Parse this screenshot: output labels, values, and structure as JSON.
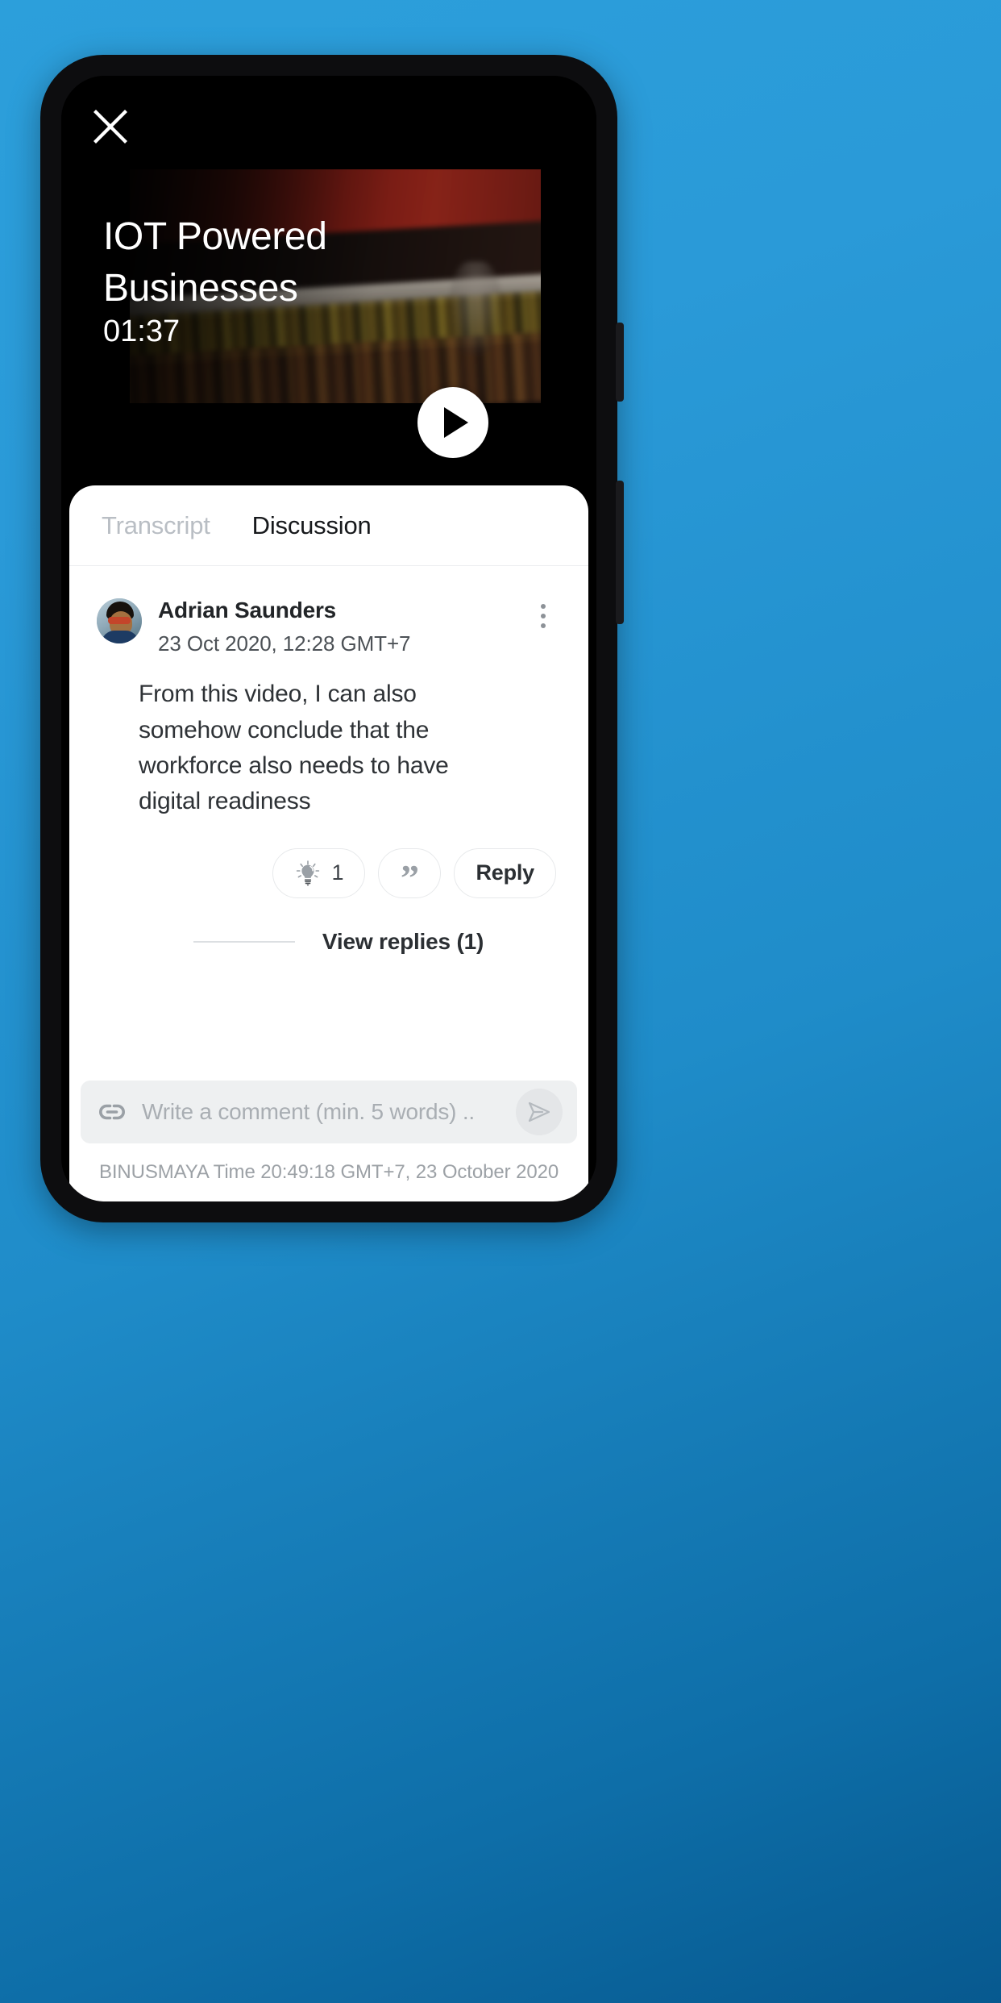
{
  "video": {
    "close_icon": "close-icon",
    "title": "IOT Powered\nBusinesses",
    "duration": "01:37",
    "play_icon": "play-icon"
  },
  "tabs": [
    {
      "label": "Transcript",
      "active": false
    },
    {
      "label": "Discussion",
      "active": true
    }
  ],
  "comment": {
    "author": "Adrian Saunders",
    "timestamp": "23 Oct 2020, 12:28 GMT+7",
    "body": "From this video, I can also somehow conclude that the workforce also needs to have digital readiness",
    "avatar_icon": "user-avatar",
    "menu_icon": "kebab-menu-icon",
    "actions": {
      "insight_icon": "lightbulb-icon",
      "insight_count": "1",
      "quote_icon": "quote-icon",
      "reply_label": "Reply"
    },
    "view_replies_label": "View replies (1)"
  },
  "composer": {
    "attach_icon": "link-icon",
    "placeholder": "Write a comment (min. 5 words) ..",
    "value": "",
    "send_icon": "send-icon"
  },
  "footer": {
    "text": "BINUSMAYA Time 20:49:18 GMT+7, 23 October 2020"
  },
  "colors": {
    "background_top": "#2c9fdb",
    "background_bottom": "#07598f",
    "sheet": "#ffffff",
    "active_tab": "#17191c",
    "inactive_tab": "#b9bec4"
  }
}
